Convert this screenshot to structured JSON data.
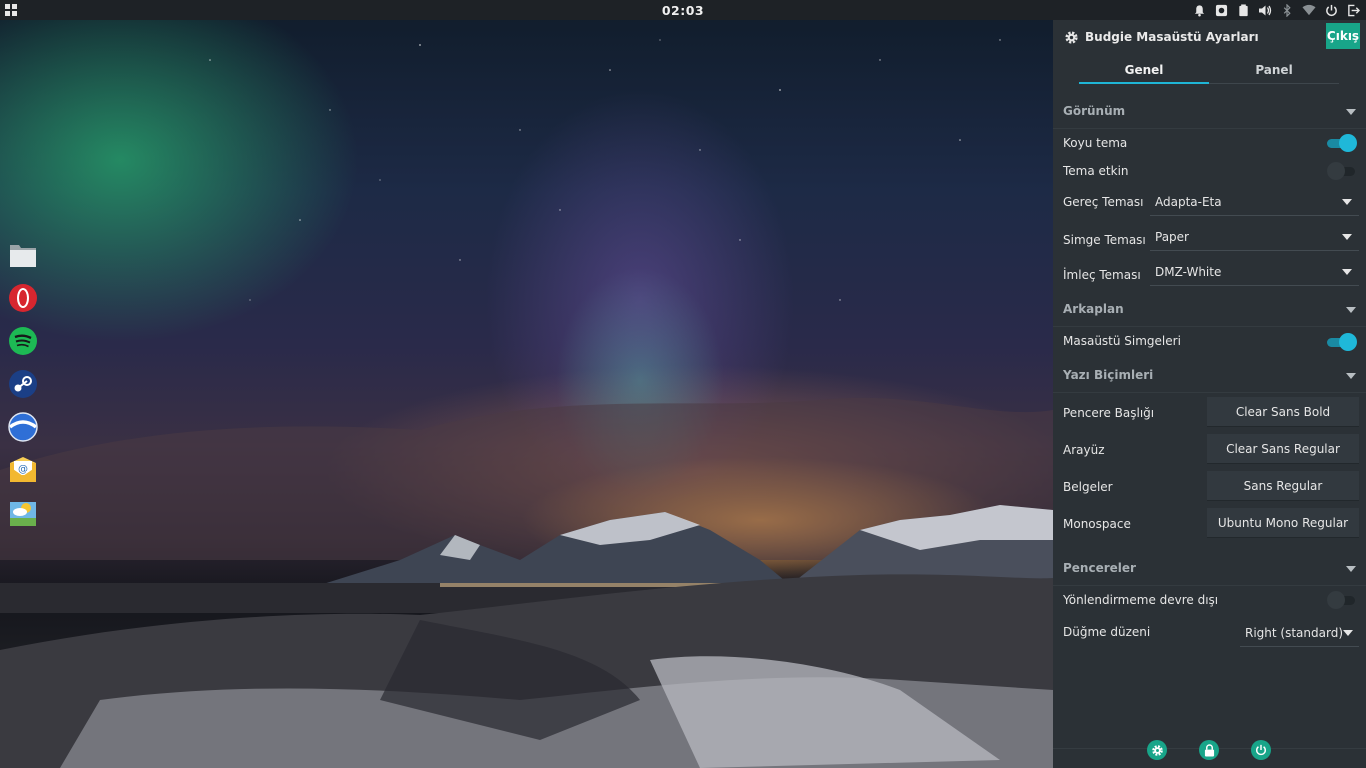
{
  "topbar": {
    "clock": "02:03",
    "tray_icons": [
      "bell-icon",
      "screenshot-icon",
      "clipboard-icon",
      "volume-icon",
      "bluetooth-icon",
      "wifi-icon",
      "power-icon",
      "logout-icon"
    ]
  },
  "dock": {
    "items": [
      "files-icon",
      "opera-icon",
      "spotify-icon",
      "steam-icon",
      "google-earth-icon",
      "mail-icon",
      "weather-icon"
    ]
  },
  "panel": {
    "title": "Budgie Masaüstü Ayarları",
    "exit_label": "Çıkış",
    "tabs": [
      {
        "label": "Genel",
        "active": true
      },
      {
        "label": "Panel",
        "active": false
      }
    ],
    "sections": {
      "appearance": "Görünüm",
      "background": "Arkaplan",
      "fonts": "Yazı Biçimleri",
      "windows": "Pencereler"
    },
    "appearance": {
      "dark_theme_label": "Koyu tema",
      "dark_theme_on": true,
      "theme_active_label": "Tema etkin",
      "theme_active_on": false,
      "widget_theme_label": "Gereç Teması",
      "widget_theme_value": "Adapta-Eta",
      "icon_theme_label": "Simge Teması",
      "icon_theme_value": "Paper",
      "cursor_theme_label": "İmleç Teması",
      "cursor_theme_value": "DMZ-White"
    },
    "background": {
      "desktop_icons_label": "Masaüstü Simgeleri",
      "desktop_icons_on": true
    },
    "fonts": {
      "window_title_label": "Pencere Başlığı",
      "window_title_value": "Clear Sans Bold",
      "interface_label": "Arayüz",
      "interface_value": "Clear Sans Regular",
      "documents_label": "Belgeler",
      "documents_value": "Sans Regular",
      "monospace_label": "Monospace",
      "monospace_value": "Ubuntu Mono Regular"
    },
    "windows": {
      "disable_redirect_label": "Yönlendirmeme devre dışı",
      "disable_redirect_on": false,
      "button_layout_label": "Düğme düzeni",
      "button_layout_value": "Right (standard)"
    },
    "bottom_buttons": [
      "settings-icon",
      "lock-icon",
      "power-icon"
    ],
    "accent_color": "#1fb8d9",
    "exit_color": "#18a589"
  }
}
